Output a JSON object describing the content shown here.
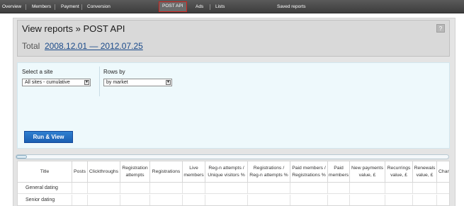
{
  "nav": {
    "items": [
      {
        "label": "Overview"
      },
      {
        "label": "Members"
      },
      {
        "label": "Payment"
      },
      {
        "label": "Conversion"
      },
      {
        "label": "POST API",
        "active": true
      },
      {
        "label": "Ads"
      },
      {
        "label": "Lists"
      },
      {
        "label": "Saved reports"
      }
    ]
  },
  "header": {
    "title": "View reports » POST API",
    "help": "?",
    "total_label": "Total",
    "date_range": "2008.12.01 — 2012.07.25"
  },
  "filters": {
    "site_label": "Select a site",
    "site_value": "All sites - cumulative",
    "rows_label": "Rows by",
    "rows_value": "by market",
    "run_button": "Run & View"
  },
  "table": {
    "columns": [
      "Title",
      "Posts",
      "Clickthroughs",
      "Registration attempts",
      "Registrations",
      "Live members",
      "Reg-n attempts / Unique visitors %",
      "Registrations / Reg-n attempts %",
      "Paid members / Registrations %",
      "Paid members",
      "New payments value, £",
      "Recurrings value, £",
      "Renewals value, £",
      "Chan"
    ],
    "rows": [
      {
        "title": "General dating"
      },
      {
        "title": "Senior dating"
      }
    ]
  },
  "colors": {
    "nav_bg": "#4a4a4a",
    "active_tab_border": "#d0231e",
    "filter_bg": "#eef9fc",
    "button_bg": "#1f6bc0",
    "link": "#1a4a8a"
  }
}
